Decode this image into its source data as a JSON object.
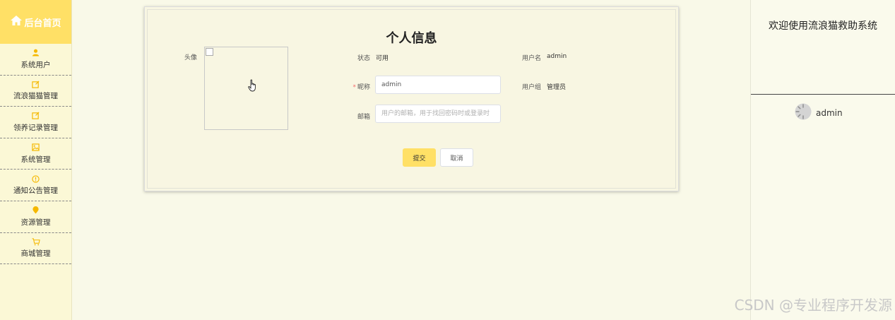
{
  "sidebar": {
    "home_label": "后台首页",
    "items": [
      {
        "label": "系统用户",
        "icon": "user-icon"
      },
      {
        "label": "流浪猫猫管理",
        "icon": "edit-icon"
      },
      {
        "label": "领养记录管理",
        "icon": "edit-icon"
      },
      {
        "label": "系统管理",
        "icon": "image-icon"
      },
      {
        "label": "通知公告管理",
        "icon": "info-icon"
      },
      {
        "label": "资源管理",
        "icon": "location-icon"
      },
      {
        "label": "商城管理",
        "icon": "cart-icon"
      }
    ]
  },
  "form": {
    "title": "个人信息",
    "avatar_label": "头像",
    "status_label": "状态",
    "status_value": "可用",
    "username_label": "用户名",
    "username_value": "admin",
    "nickname_label": "昵称",
    "nickname_value": "admin",
    "group_label": "用户组",
    "group_value": "管理员",
    "email_label": "邮箱",
    "email_placeholder": "用户的邮箱，用于找回密码时或登录时",
    "submit_label": "提交",
    "cancel_label": "取消"
  },
  "right_panel": {
    "welcome": "欢迎使用流浪猫救助系统",
    "username": "admin"
  },
  "watermark": "CSDN @专业程序开发源",
  "colors": {
    "accent": "#ffe066",
    "icon": "#f5b800",
    "background": "#f9f9e8"
  }
}
